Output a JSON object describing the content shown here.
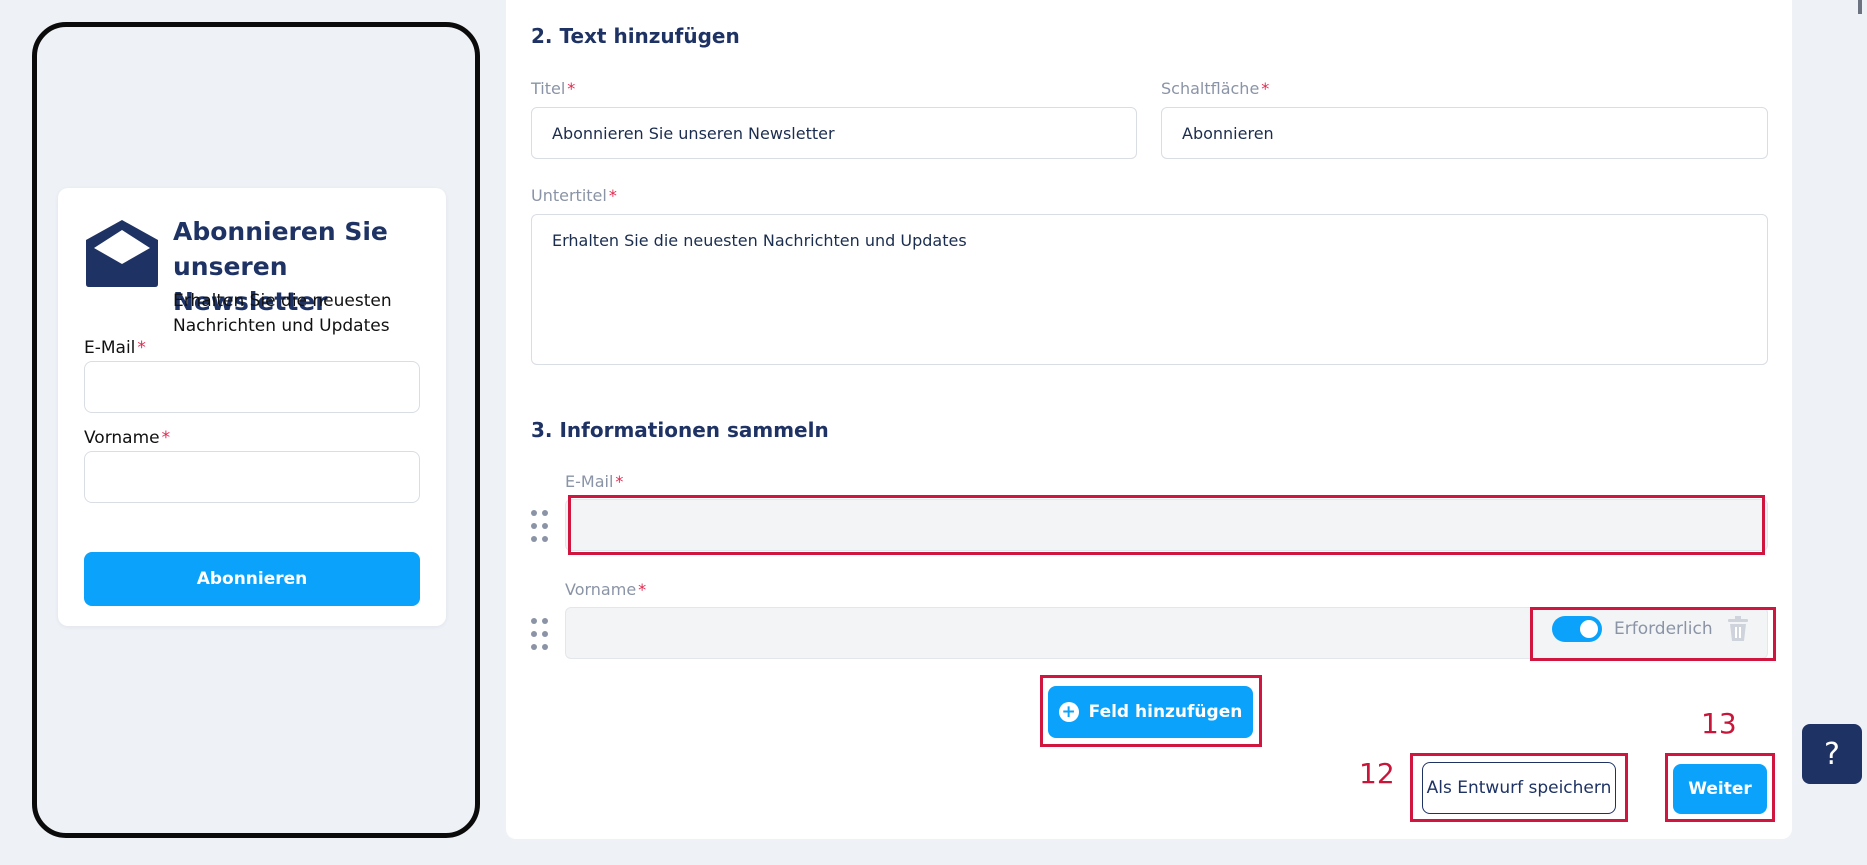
{
  "preview": {
    "title": "Abonnieren Sie unseren Newsletter",
    "subtitle": "Erhalten Sie die neuesten Nachrichten und Updates",
    "fields": [
      {
        "label": "E-Mail",
        "required": "*"
      },
      {
        "label": "Vorname",
        "required": "*"
      }
    ],
    "button": "Abonnieren",
    "icon": "envelope-open-icon"
  },
  "section_text": {
    "heading": "2. Text hinzufügen",
    "title_label": "Titel",
    "title_value": "Abonnieren Sie unseren Newsletter",
    "button_label": "Schaltfläche",
    "button_value": "Abonnieren",
    "subtitle_label": "Untertitel",
    "subtitle_value": "Erhalten Sie die neuesten Nachrichten und Updates",
    "required_mark": "*"
  },
  "section_fields": {
    "heading": "3. Informationen sammeln",
    "fields": [
      {
        "label": "E-Mail",
        "required": "*"
      },
      {
        "label": "Vorname",
        "required": "*"
      }
    ],
    "toggle_label": "Erforderlich",
    "toggle_on": true,
    "add_field": "Feld hinzufügen"
  },
  "actions": {
    "draft": "Als Entwurf speichern",
    "next": "Weiter"
  },
  "annotations": {
    "step_12": "12",
    "step_13": "13"
  },
  "help": {
    "label": "?"
  },
  "colors": {
    "accent": "#0aa2fb",
    "navy": "#1e3264",
    "required": "#e2294f",
    "highlight": "#d0163e"
  }
}
